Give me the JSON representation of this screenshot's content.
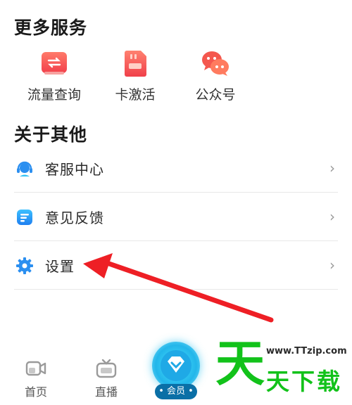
{
  "more_services": {
    "title": "更多服务",
    "items": [
      {
        "label": "流量查询",
        "icon": "data-usage-icon"
      },
      {
        "label": "卡激活",
        "icon": "sim-card-icon"
      },
      {
        "label": "公众号",
        "icon": "wechat-official-account-icon"
      }
    ]
  },
  "about": {
    "title": "关于其他",
    "items": [
      {
        "label": "客服中心",
        "icon": "headset-icon"
      },
      {
        "label": "意见反馈",
        "icon": "feedback-icon"
      },
      {
        "label": "设置",
        "icon": "gear-icon"
      }
    ],
    "chevron": "›"
  },
  "tabbar": {
    "home_label": "首页",
    "live_label": "直播",
    "vip_label": "• 会员 •"
  },
  "watermark": {
    "url": "www.TTzip.com",
    "big_char": "天",
    "text": "天下载"
  },
  "colors": {
    "accent_red": "#f2404b",
    "tab_blue": "#22b6ea",
    "watermark_green": "#12c21a"
  }
}
